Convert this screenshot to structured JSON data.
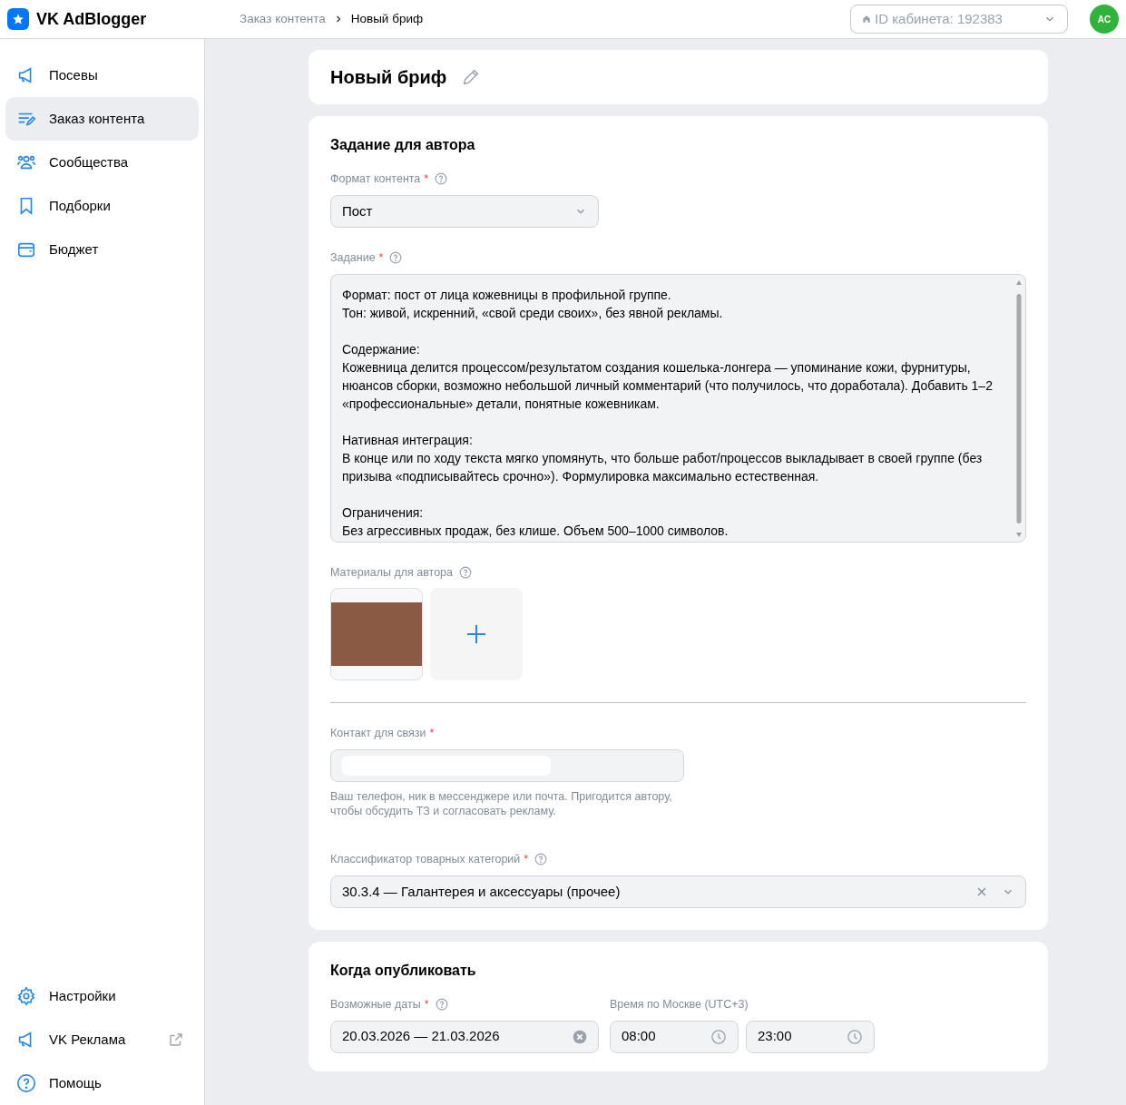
{
  "app": {
    "name": "VK AdBlogger"
  },
  "breadcrumbs": [
    {
      "label": "Заказ контента",
      "current": false
    },
    {
      "label": "Новый бриф",
      "current": true
    }
  ],
  "cabinet_select": {
    "value": "ID кабинета: 192383"
  },
  "avatar": {
    "initials": "AC"
  },
  "sidebar": {
    "items": [
      {
        "label": "Посевы",
        "selected": false
      },
      {
        "label": "Заказ контента",
        "selected": true
      },
      {
        "label": "Сообщества",
        "selected": false
      },
      {
        "label": "Подборки",
        "selected": false
      },
      {
        "label": "Бюджет",
        "selected": false
      }
    ],
    "bottom_items": [
      {
        "label": "Настройки",
        "external": false
      },
      {
        "label": "VK Реклама",
        "external": true
      },
      {
        "label": "Помощь",
        "external": false
      }
    ]
  },
  "page_title": "Новый бриф",
  "task_section": {
    "title": "Задание для автора",
    "format": {
      "label": "Формат контента",
      "required_mark": "*",
      "help": true,
      "value": "Пост"
    },
    "task": {
      "label": "Задание",
      "required_mark": "*",
      "help": true,
      "value": "Формат: пост от лица кожевницы в профильной группе.\nТон: живой, искренний, «свой среди своих», без явной рекламы.\n\nСодержание:\nКожевница делится процессом/результатом создания кошелька-лонгера — упоминание кожи, фурнитуры, нюансов сборки, возможно небольшой личный комментарий (что получилось, что доработала). Добавить 1–2 «профессиональные» детали, понятные кожевникам.\n\nНативная интеграция:\nВ конце или по ходу текста мягко упомянуть, что больше работ/процессов выкладывает в своей группе (без призыва «подписывайтесь срочно»). Формулировка максимально естественная.\n\nОграничения:\nБез агрессивных продаж, без клише. Объем 500–1000 символов."
    },
    "materials": {
      "label": "Материалы для автора",
      "help": true
    },
    "contact": {
      "label": "Контакт для связи",
      "required_mark": "*",
      "hint": "Ваш телефон, ник в мессенджере или почта. Пригодится автору, чтобы обсудить ТЗ и согласовать рекламу."
    },
    "category": {
      "label": "Классификатор товарных категорий",
      "required_mark": "*",
      "help": true,
      "value": "30.3.4 — Галантерея и аксессуары (прочее)"
    }
  },
  "publish_section": {
    "title": "Когда опубликовать",
    "dates": {
      "label": "Возможные даты",
      "required_mark": "*",
      "help": true,
      "value": "20.03.2026 — 21.03.2026"
    },
    "time": {
      "label": "Время по Москве (UTC+3)",
      "from": "08:00",
      "to": "23:00"
    }
  }
}
